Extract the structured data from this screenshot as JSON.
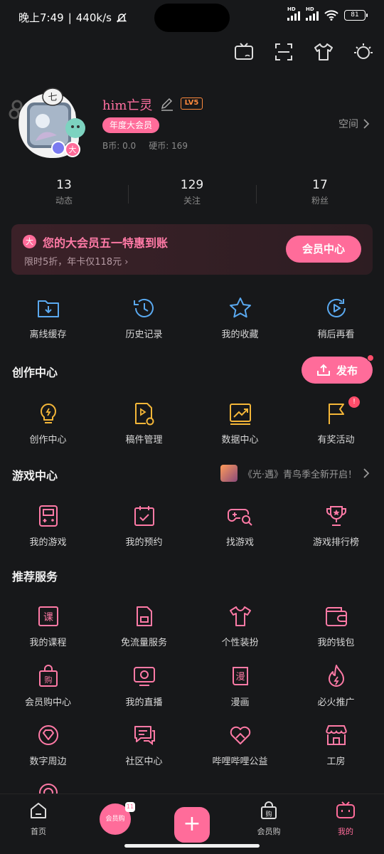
{
  "status_bar": {
    "time": "晚上7:49",
    "speed": "440k/s",
    "battery": "81"
  },
  "top_icons": [
    "tv-icon",
    "scan-icon",
    "tshirt-icon",
    "theme-icon"
  ],
  "profile": {
    "username": "him亡灵",
    "level": "LV5",
    "vip_label": "年度大会员",
    "bcoin": "B币: 0.0",
    "coin": "硬币: 169",
    "space_link": "空间",
    "avatar_badge": "七",
    "avatar_vip_mark": "大"
  },
  "stats": [
    {
      "num": "13",
      "label": "动态"
    },
    {
      "num": "129",
      "label": "关注"
    },
    {
      "num": "17",
      "label": "粉丝"
    }
  ],
  "vip_card": {
    "icon": "大",
    "title": "您的大会员五一特惠到账",
    "subtitle": "限时5折，年卡仅118元 ›",
    "button": "会员中心",
    "accent": "#ff6c9a"
  },
  "quick": [
    {
      "label": "离线缓存",
      "icon": "download-icon"
    },
    {
      "label": "历史记录",
      "icon": "history-icon"
    },
    {
      "label": "我的收藏",
      "icon": "star-icon"
    },
    {
      "label": "稍后再看",
      "icon": "watch-later-icon"
    }
  ],
  "creation": {
    "title": "创作中心",
    "publish": "发布",
    "items": [
      {
        "label": "创作中心",
        "icon": "bulb-icon"
      },
      {
        "label": "稿件管理",
        "icon": "manuscript-icon"
      },
      {
        "label": "数据中心",
        "icon": "chart-icon"
      },
      {
        "label": "有奖活动",
        "icon": "flag-icon",
        "badge": "!"
      }
    ]
  },
  "games": {
    "title": "游戏中心",
    "promo": "《光·遇》青鸟季全新开启！",
    "items": [
      {
        "label": "我的游戏",
        "icon": "gameboy-icon"
      },
      {
        "label": "我的预约",
        "icon": "calendar-check-icon"
      },
      {
        "label": "找游戏",
        "icon": "gamepad-search-icon"
      },
      {
        "label": "游戏排行榜",
        "icon": "trophy-icon"
      }
    ]
  },
  "services": {
    "title": "推荐服务",
    "rows": [
      [
        {
          "label": "我的课程",
          "icon": "course-icon",
          "glyph": "课"
        },
        {
          "label": "免流量服务",
          "icon": "sim-icon"
        },
        {
          "label": "个性装扮",
          "icon": "tshirt-icon"
        },
        {
          "label": "我的钱包",
          "icon": "wallet-icon"
        }
      ],
      [
        {
          "label": "会员购中心",
          "icon": "shopping-bag-icon",
          "glyph": "购"
        },
        {
          "label": "我的直播",
          "icon": "live-icon"
        },
        {
          "label": "漫画",
          "icon": "comic-icon",
          "glyph": "漫"
        },
        {
          "label": "必火推广",
          "icon": "fire-icon"
        }
      ],
      [
        {
          "label": "数字周边",
          "icon": "diamond-icon"
        },
        {
          "label": "社区中心",
          "icon": "community-icon"
        },
        {
          "label": "哔哩哔哩公益",
          "icon": "heart-hands-icon"
        },
        {
          "label": "工房",
          "icon": "store-icon"
        }
      ]
    ]
  },
  "bottom_nav": [
    {
      "label": "首页",
      "icon": "home-icon"
    },
    {
      "label": "",
      "icon": "mall-icon",
      "mall_text": "会员购",
      "mall_tag": "11"
    },
    {
      "label": "",
      "icon": "plus-icon",
      "plus": "+"
    },
    {
      "label": "会员购",
      "icon": "shopping-bag-icon",
      "glyph": "购"
    },
    {
      "label": "我的",
      "icon": "tv-mine-icon"
    }
  ]
}
